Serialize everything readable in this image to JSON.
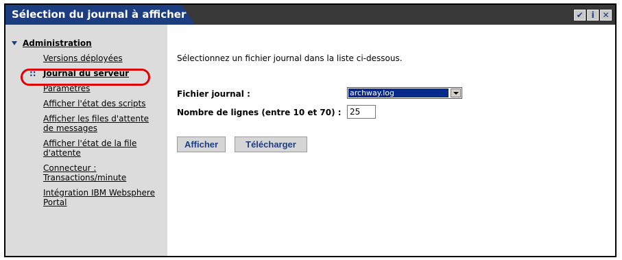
{
  "window": {
    "title": "Sélection du journal à afficher"
  },
  "titlebar_icons": [
    {
      "name": "checkmark-icon",
      "glyph": "✔"
    },
    {
      "name": "info-icon",
      "glyph": "i"
    },
    {
      "name": "close-icon",
      "glyph": "✕"
    }
  ],
  "sidebar": {
    "section_label": "Administration",
    "items": [
      {
        "label": "Versions déployées",
        "active": false
      },
      {
        "label": "Journal du serveur",
        "active": true
      },
      {
        "label": "Paramètres",
        "active": false
      },
      {
        "label": "Afficher l'état des scripts",
        "active": false
      },
      {
        "label": "Afficher les files d'attente de messages",
        "active": false
      },
      {
        "label": "Afficher l'état de la file d'attente",
        "active": false
      },
      {
        "label": "Connecteur : Transactions/minute",
        "active": false
      },
      {
        "label": "Intégration IBM Websphere Portal",
        "active": false
      }
    ],
    "active_marker": "::"
  },
  "main": {
    "intro": "Sélectionnez un fichier journal dans la liste ci-dessous.",
    "log_file_label": "Fichier journal :",
    "log_file_value": "archway.log",
    "lines_label": "Nombre de lignes (entre 10 et 70) :",
    "lines_value": "25",
    "show_button": "Afficher",
    "download_button": "Télécharger"
  },
  "colors": {
    "title_bg": "#1d3d82",
    "titlebar_bg": "#383838",
    "sidebar_bg": "#dcdcdc",
    "highlight": "#e00000"
  }
}
